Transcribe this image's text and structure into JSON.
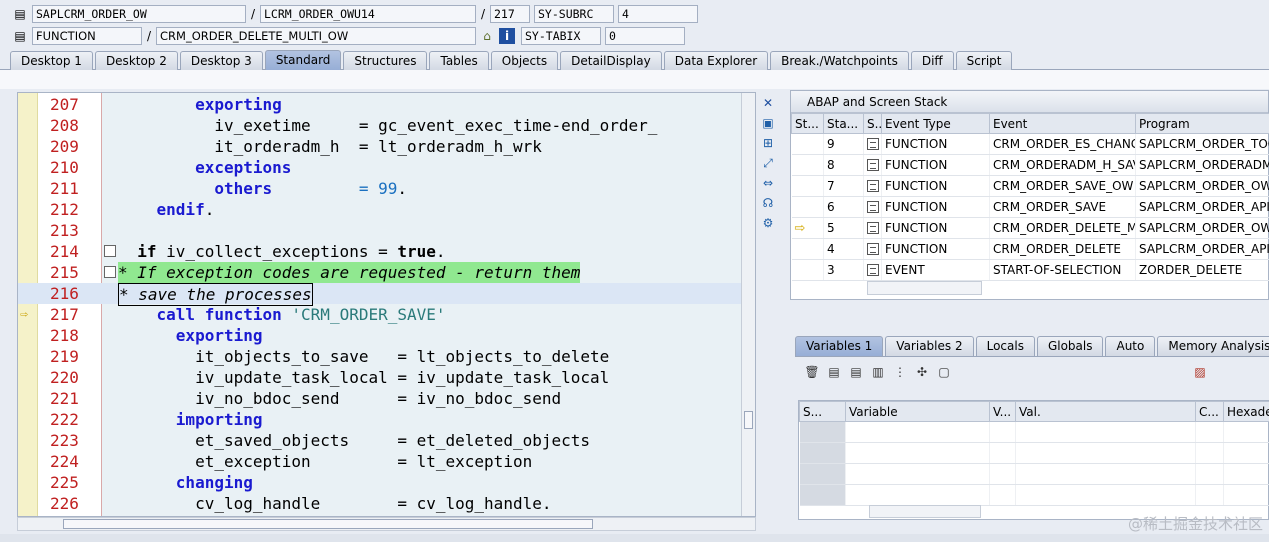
{
  "header": {
    "row1": {
      "program": "SAPLCRM_ORDER_OW",
      "include": "LCRM_ORDER_OWU14",
      "line": "217",
      "sysfield1": "SY-SUBRC",
      "sysval1": "4"
    },
    "row2": {
      "kind": "FUNCTION",
      "name": "CRM_ORDER_DELETE_MULTI_OW",
      "sysfield2": "SY-TABIX",
      "sysval2": "0"
    },
    "sep": "/"
  },
  "tabs": [
    "Desktop 1",
    "Desktop 2",
    "Desktop 3",
    "Standard",
    "Structures",
    "Tables",
    "Objects",
    "DetailDisplay",
    "Data Explorer",
    "Break./Watchpoints",
    "Diff",
    "Script"
  ],
  "active_tab": "Standard",
  "editor": {
    "lines": [
      {
        "n": "207",
        "t": "        exporting"
      },
      {
        "n": "208",
        "t": "          iv_exetime     = gc_event_exec_time-end_order_"
      },
      {
        "n": "209",
        "t": "          it_orderadm_h  = lt_orderadm_h_wrk"
      },
      {
        "n": "210",
        "t": "        exceptions"
      },
      {
        "n": "211",
        "t": "          others         = 99."
      },
      {
        "n": "212",
        "t": "    endif."
      },
      {
        "n": "213",
        "t": ""
      },
      {
        "n": "214",
        "t": "  if iv_collect_exceptions = true."
      },
      {
        "n": "215",
        "t": "* If exception codes are requested - return them"
      },
      {
        "n": "216",
        "t": "* save the processes"
      },
      {
        "n": "217",
        "t": "    call function 'CRM_ORDER_SAVE'"
      },
      {
        "n": "218",
        "t": "      exporting"
      },
      {
        "n": "219",
        "t": "        it_objects_to_save   = lt_objects_to_delete"
      },
      {
        "n": "220",
        "t": "        iv_update_task_local = iv_update_task_local"
      },
      {
        "n": "221",
        "t": "        iv_no_bdoc_send      = iv_no_bdoc_send"
      },
      {
        "n": "222",
        "t": "      importing"
      },
      {
        "n": "223",
        "t": "        et_saved_objects     = et_deleted_objects"
      },
      {
        "n": "224",
        "t": "        et_exception         = lt_exception"
      },
      {
        "n": "225",
        "t": "      changing"
      },
      {
        "n": "226",
        "t": "        cv_log_handle        = cv_log_handle."
      }
    ]
  },
  "stack": {
    "title": "ABAP and Screen Stack",
    "columns": [
      "St...",
      "Sta...",
      "S...",
      "Event Type",
      "Event",
      "Program"
    ],
    "rows": [
      {
        "level": "9",
        "type": "FUNCTION",
        "event": "CRM_ORDER_ES_CHANG...",
        "program": "SAPLCRM_ORDER_TOO",
        "current": false
      },
      {
        "level": "8",
        "type": "FUNCTION",
        "event": "CRM_ORDERADM_H_SAV...",
        "program": "SAPLCRM_ORDERADM_I",
        "current": false
      },
      {
        "level": "7",
        "type": "FUNCTION",
        "event": "CRM_ORDER_SAVE_OW",
        "program": "SAPLCRM_ORDER_OW",
        "current": false
      },
      {
        "level": "6",
        "type": "FUNCTION",
        "event": "CRM_ORDER_SAVE",
        "program": "SAPLCRM_ORDER_API",
        "current": false
      },
      {
        "level": "5",
        "type": "FUNCTION",
        "event": "CRM_ORDER_DELETE_M...",
        "program": "SAPLCRM_ORDER_OW",
        "current": true
      },
      {
        "level": "4",
        "type": "FUNCTION",
        "event": "CRM_ORDER_DELETE",
        "program": "SAPLCRM_ORDER_API",
        "current": false
      },
      {
        "level": "3",
        "type": "EVENT",
        "event": "START-OF-SELECTION",
        "program": "ZORDER_DELETE",
        "current": false
      }
    ]
  },
  "vars": {
    "tabs": [
      "Variables 1",
      "Variables 2",
      "Locals",
      "Globals",
      "Auto",
      "Memory Analysis"
    ],
    "active": "Variables 1",
    "columns": [
      "S...",
      "Variable",
      "V...",
      "Val.",
      "C...",
      "Hexadec"
    ]
  },
  "watermark": "@稀土掘金技术社区"
}
